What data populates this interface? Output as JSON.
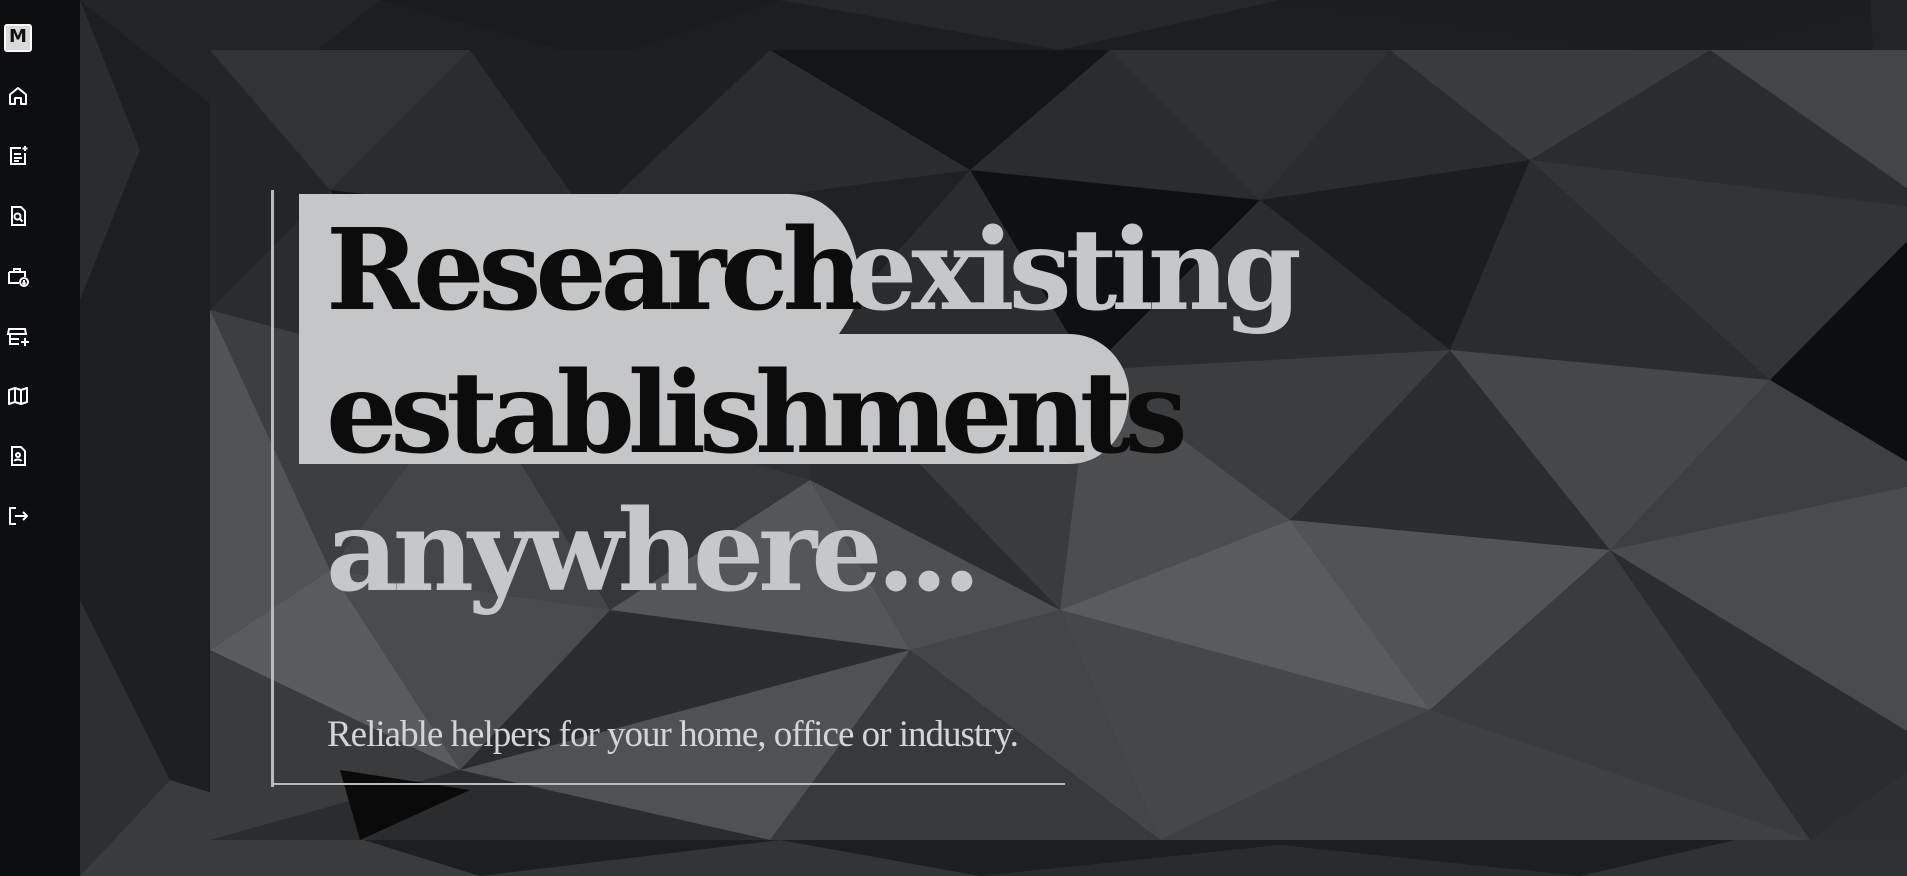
{
  "app": {
    "logo_letter": "M"
  },
  "sidebar": {
    "items": [
      {
        "name": "home",
        "icon": "home-icon"
      },
      {
        "name": "notes",
        "icon": "note-add-icon"
      },
      {
        "name": "search-document",
        "icon": "document-search-icon"
      },
      {
        "name": "work-download",
        "icon": "briefcase-download-icon"
      },
      {
        "name": "add-store",
        "icon": "store-add-icon"
      },
      {
        "name": "map",
        "icon": "map-icon"
      },
      {
        "name": "contact-document",
        "icon": "user-document-icon"
      },
      {
        "name": "logout",
        "icon": "logout-icon"
      }
    ]
  },
  "hero": {
    "word_research": "Research",
    "word_existing": "existing",
    "word_establishments": "establishments",
    "word_anywhere": "anywhere...",
    "tagline": "Reliable helpers for your home, office or industry."
  },
  "colors": {
    "sidebar_bg": "#0c0e12",
    "highlight": "#c5c6c8",
    "headline_dark": "#0c0c0c",
    "headline_light": "#c6c7c9",
    "accent_line": "#b9babc"
  }
}
